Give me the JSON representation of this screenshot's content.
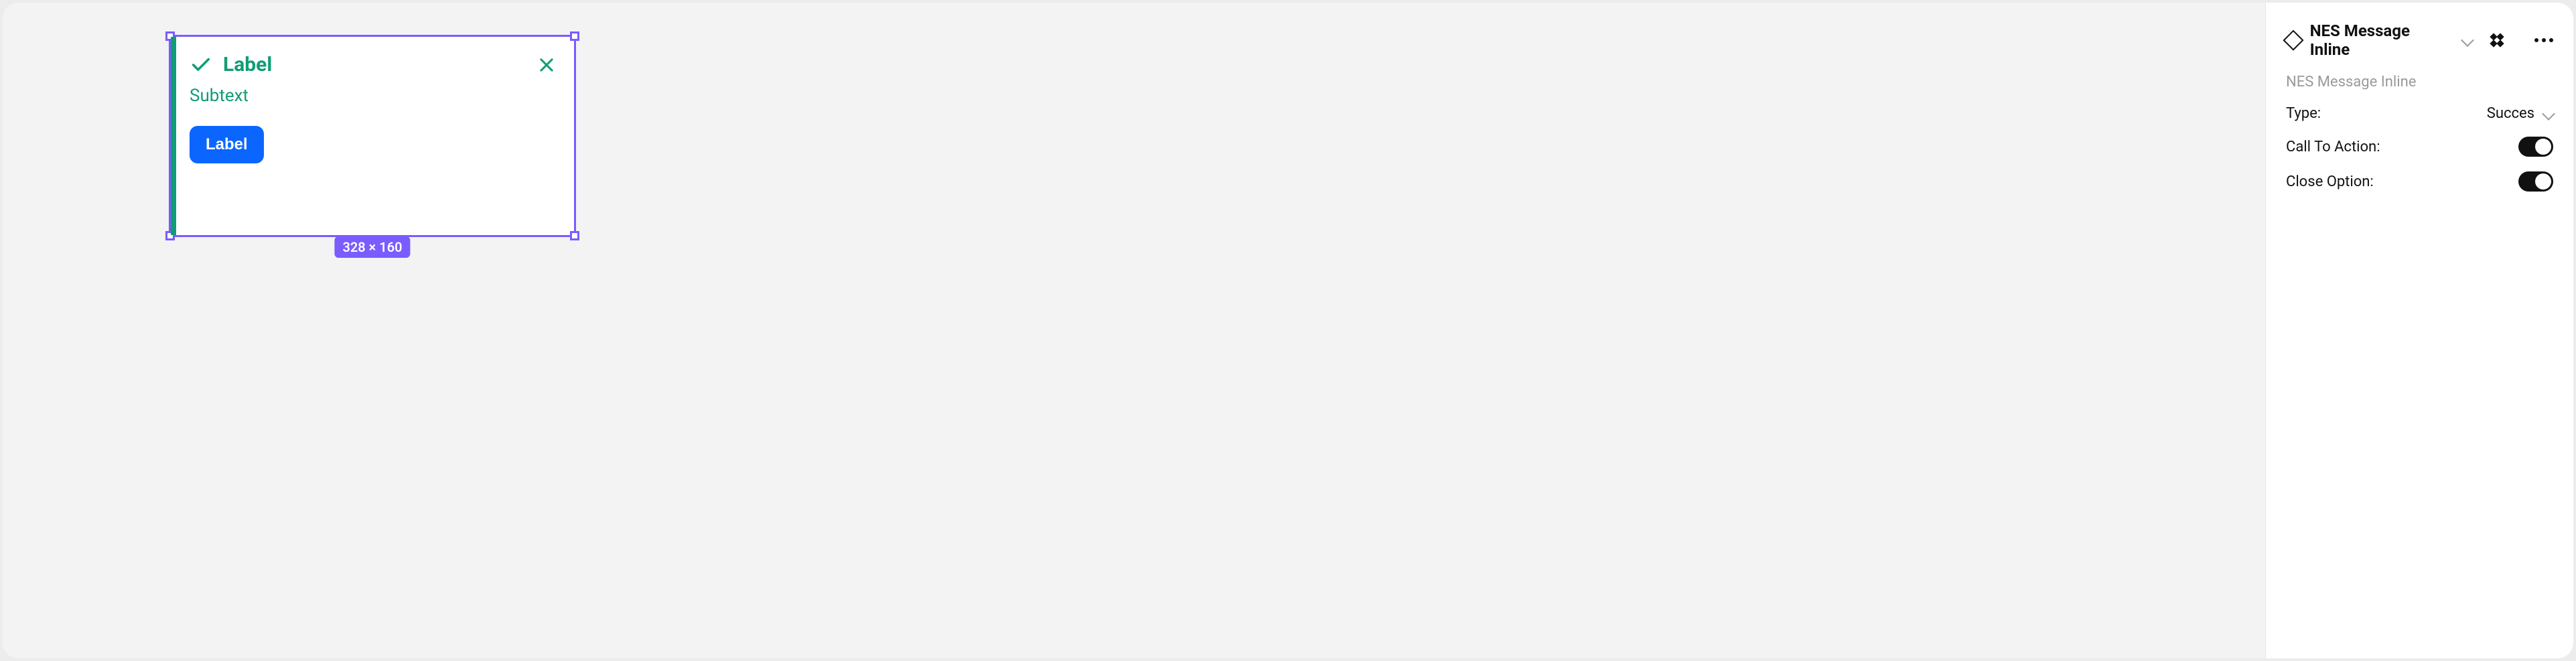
{
  "canvas": {
    "selection_dimensions": "328 × 160"
  },
  "component": {
    "title": "Label",
    "subtext": "Subtext",
    "cta_label": "Label",
    "accent_color": "#0f9d76",
    "cta_color": "#0a66ff"
  },
  "inspector": {
    "title": "NES Message Inline",
    "subtitle": "NES Message Inline",
    "props": {
      "type_label": "Type:",
      "type_value": "Succes",
      "cta_label": "Call To Action:",
      "cta_on": true,
      "close_label": "Close Option:",
      "close_on": true
    }
  }
}
